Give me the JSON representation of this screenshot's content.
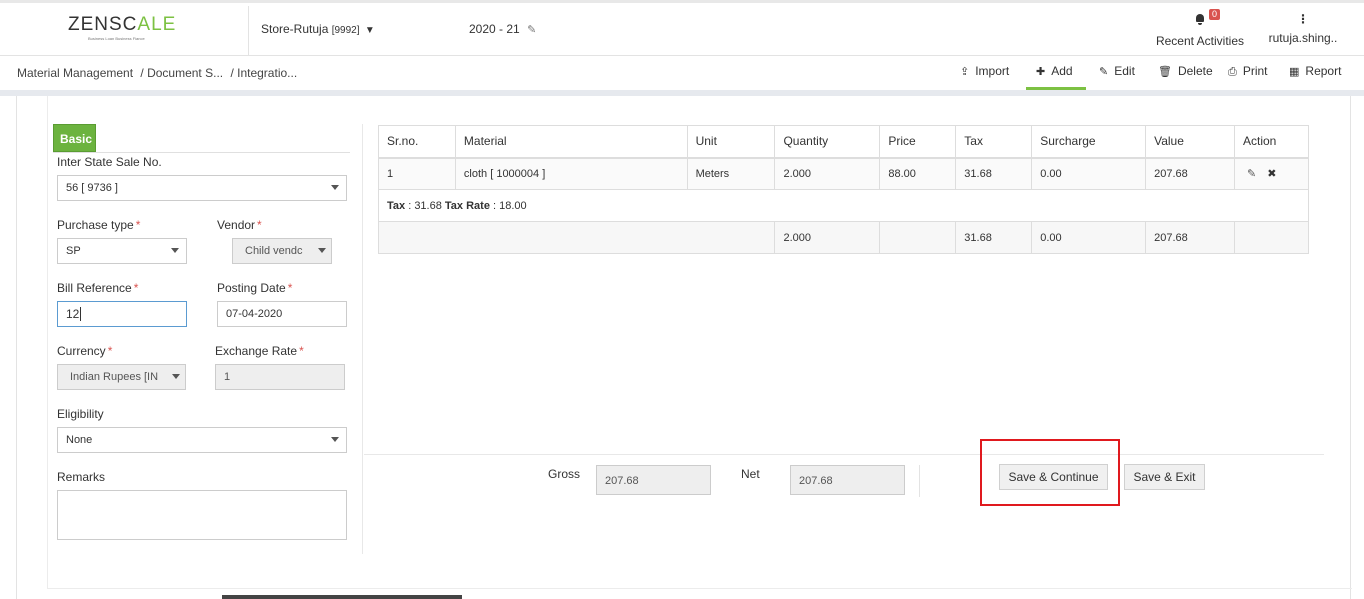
{
  "header": {
    "logo_main_prefix": "ZENSC",
    "logo_main_mid": "A",
    "logo_main_suffix": "LE",
    "logo_tagline": "Business Loan Business Fiance",
    "store_name": "Store-Rutuja",
    "store_code": "[9992]",
    "fiscal_year": "2020 - 21",
    "notifications_count": "0",
    "activities_label": "Recent Activities",
    "user_label": "rutuja.shing.."
  },
  "breadcrumb": [
    "Material Management",
    "/ Document S...",
    "/ Integratio..."
  ],
  "toolbar": {
    "import": "Import",
    "add": "Add",
    "edit": "Edit",
    "delete": "Delete",
    "print": "Print",
    "report": "Report"
  },
  "form": {
    "tab_label": "Basic",
    "inter_state_label": "Inter State Sale No.",
    "inter_state_value": "56 [ 9736 ]",
    "purchase_type_label": "Purchase type",
    "purchase_type_value": "SP",
    "vendor_label": "Vendor",
    "vendor_value": "Child vendc",
    "bill_ref_label": "Bill Reference",
    "bill_ref_value": "12",
    "posting_date_label": "Posting Date",
    "posting_date_value": "07-04-2020",
    "currency_label": "Currency",
    "currency_value": "Indian Rupees [IN",
    "exchange_rate_label": "Exchange Rate",
    "exchange_rate_value": "1",
    "eligibility_label": "Eligibility",
    "eligibility_value": "None",
    "remarks_label": "Remarks",
    "required_mark": "*"
  },
  "table": {
    "headers": [
      "Sr.no.",
      "Material",
      "Unit",
      "Quantity",
      "Price",
      "Tax",
      "Surcharge",
      "Value",
      "Action"
    ],
    "row": {
      "srno": "1",
      "material": "cloth [ 1000004 ]",
      "unit": "Meters",
      "quantity": "2.000",
      "price": "88.00",
      "tax": "31.68",
      "surcharge": "0.00",
      "value": "207.68"
    },
    "tax_line": {
      "tax_label": "Tax",
      "tax_value": ": 31.68",
      "rate_label": "Tax Rate",
      "rate_value": ": 18.00"
    },
    "totals": {
      "quantity": "2.000",
      "tax": "31.68",
      "surcharge": "0.00",
      "value": "207.68"
    }
  },
  "footer": {
    "gross_label": "Gross",
    "gross_value": "207.68",
    "net_label": "Net",
    "net_value": "207.68",
    "save_continue": "Save & Continue",
    "save_exit": "Save & Exit"
  },
  "colors": {
    "accent_green": "#6cb33f",
    "highlight_red": "#e0191e",
    "required_red": "#d9534f"
  }
}
